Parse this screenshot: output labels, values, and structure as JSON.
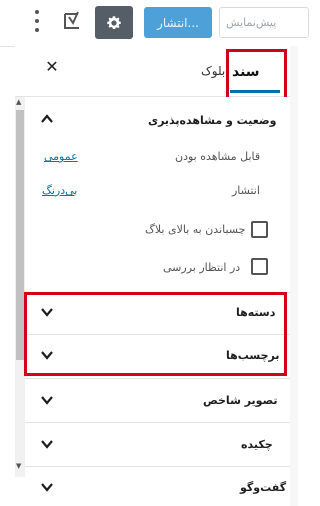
{
  "toolbar": {
    "more_icon": "vertical-dots-icon",
    "yoast_icon": "yoast-logo-icon",
    "settings_icon": "gear-icon",
    "publish_label": "انتشار...",
    "preview_label": "پیش‌نمایش"
  },
  "sidebar": {
    "tabs": [
      {
        "label": "سند",
        "active": true
      },
      {
        "label": "بلوک",
        "active": false
      }
    ],
    "close_icon": "close-icon"
  },
  "status": {
    "title": "وضعیت و مشاهده‌پذیری",
    "visibility_label": "قابل مشاهده بودن",
    "visibility_value": "عمومی",
    "publish_label": "انتشار",
    "publish_value": "بی‌درنگ",
    "sticky_label": "چسباندن به بالای بلاگ",
    "pending_label": "در انتظار بررسی"
  },
  "panels": {
    "categories": "دسته‌ها",
    "tags": "برچسب‌ها",
    "featured_image": "تصویر شاخص",
    "excerpt": "چکیده",
    "discussion": "گفت‌وگو"
  },
  "colors": {
    "highlight": "#d0021b",
    "accent": "#0073aa"
  }
}
